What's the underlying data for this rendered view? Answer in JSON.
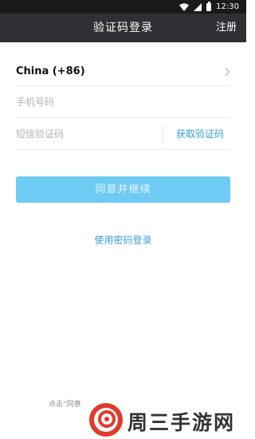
{
  "status_bar": {
    "time": "12:30"
  },
  "nav": {
    "title": "验证码登录",
    "register_label": "注册"
  },
  "form": {
    "country": "China (+86)",
    "phone_placeholder": "手机号码",
    "sms_placeholder": "短信验证码",
    "get_code_label": "获取验证码"
  },
  "submit_label": "同意并继续",
  "password_login_label": "使用密码登录",
  "agreement_prefix": "点击“同意",
  "watermark": {
    "text": "周三手游网"
  },
  "colors": {
    "accent": "#3a9fd6",
    "button": "#6ecbf3",
    "nav_bg": "#2f2f35",
    "status_bg": "#1a1a1a"
  }
}
